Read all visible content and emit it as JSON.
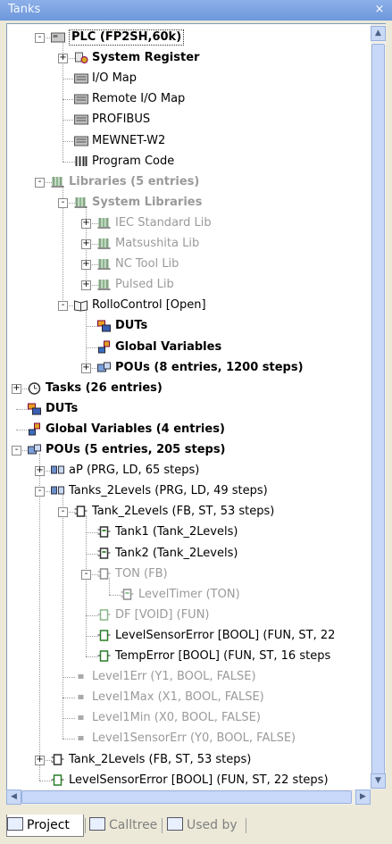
{
  "window": {
    "title": "Tanks",
    "close_label": "×"
  },
  "tree": [
    {
      "text": "PLC (FP2SH,60k)",
      "x": 2,
      "bold": true,
      "exp": "-",
      "icon": "plc-icon"
    },
    {
      "text": "System Register",
      "x": 3,
      "bold": true,
      "exp": "+",
      "icon": "system-register-icon"
    },
    {
      "text": "I/O Map",
      "x": 3,
      "icon": "io-map-icon"
    },
    {
      "text": "Remote I/O Map",
      "x": 3,
      "icon": "remote-io-map-icon"
    },
    {
      "text": "PROFIBUS",
      "x": 3,
      "icon": "profibus-icon"
    },
    {
      "text": "MEWNET-W2",
      "x": 3,
      "icon": "mewnet-icon"
    },
    {
      "text": "Program Code",
      "x": 3,
      "icon": "program-code-icon"
    },
    {
      "text": "Libraries (5 entries)",
      "x": 2,
      "bold": true,
      "gray": true,
      "exp": "-",
      "icon": "library-icon"
    },
    {
      "text": "System Libraries",
      "x": 3,
      "bold": true,
      "gray": true,
      "exp": "-",
      "icon": "library-icon"
    },
    {
      "text": "IEC Standard Lib",
      "x": 4,
      "gray": true,
      "exp": "+",
      "icon": "library-icon"
    },
    {
      "text": "Matsushita Lib",
      "x": 4,
      "gray": true,
      "exp": "+",
      "icon": "library-icon"
    },
    {
      "text": "NC Tool Lib",
      "x": 4,
      "gray": true,
      "exp": "+",
      "icon": "library-icon"
    },
    {
      "text": "Pulsed Lib",
      "x": 4,
      "gray": true,
      "exp": "+",
      "icon": "library-icon"
    },
    {
      "text": "RolloControl [Open]",
      "x": 3,
      "exp": "-",
      "icon": "open-book-icon"
    },
    {
      "text": "DUTs",
      "x": 4,
      "bold": true,
      "icon": "dut-icon"
    },
    {
      "text": "Global Variables",
      "x": 4,
      "bold": true,
      "icon": "global-variables-icon"
    },
    {
      "text": "POUs (8 entries, 1200 steps)",
      "x": 4,
      "bold": true,
      "exp": "+",
      "icon": "pou-folder-icon"
    },
    {
      "text": "Tasks (26 entries)",
      "x": 1,
      "bold": true,
      "exp": "+",
      "icon": "clock-icon"
    },
    {
      "text": "DUTs",
      "x": 1,
      "bold": true,
      "icon": "dut-icon"
    },
    {
      "text": "Global Variables (4 entries)",
      "x": 1,
      "bold": true,
      "icon": "global-variables-icon"
    },
    {
      "text": "POUs (5 entries, 205 steps)",
      "x": 1,
      "bold": true,
      "exp": "-",
      "icon": "pou-folder-icon"
    },
    {
      "text": "aP (PRG, LD, 65 steps)",
      "x": 2,
      "exp": "+",
      "icon": "program-icon"
    },
    {
      "text": "Tanks_2Levels (PRG, LD, 49 steps)",
      "x": 2,
      "exp": "-",
      "icon": "program-icon"
    },
    {
      "text": "Tank_2Levels (FB, ST, 53 steps)",
      "x": 3,
      "exp": "-",
      "icon": "function-block-icon"
    },
    {
      "text": "Tank1 (Tank_2Levels)",
      "x": 4,
      "icon": "instance-icon"
    },
    {
      "text": "Tank2 (Tank_2Levels)",
      "x": 4,
      "icon": "instance-icon"
    },
    {
      "text": "TON (FB)",
      "x": 4,
      "gray": true,
      "exp": "-",
      "icon": "function-block-icon"
    },
    {
      "text": "LevelTimer (TON)",
      "x": 5,
      "gray": true,
      "icon": "instance-icon"
    },
    {
      "text": "DF [VOID] (FUN)",
      "x": 4,
      "gray": true,
      "icon": "function-icon"
    },
    {
      "text": "LevelSensorError [BOOL] (FUN, ST, 22",
      "x": 4,
      "icon": "function-icon"
    },
    {
      "text": "TempError [BOOL] (FUN, ST, 16 steps",
      "x": 4,
      "icon": "function-icon"
    },
    {
      "text": "Level1Err (Y1, BOOL, FALSE)",
      "x": 3,
      "gray": true,
      "icon": "variable-icon"
    },
    {
      "text": "Level1Max (X1, BOOL, FALSE)",
      "x": 3,
      "gray": true,
      "icon": "variable-icon"
    },
    {
      "text": "Level1Min (X0, BOOL, FALSE)",
      "x": 3,
      "gray": true,
      "icon": "variable-icon"
    },
    {
      "text": "Level1SensorErr (Y0, BOOL, FALSE)",
      "x": 3,
      "gray": true,
      "icon": "variable-icon"
    },
    {
      "text": "Tank_2Levels (FB, ST, 53 steps)",
      "x": 2,
      "exp": "+",
      "icon": "function-block-icon"
    },
    {
      "text": "LevelSensorError [BOOL] (FUN, ST, 22 steps)",
      "x": 2,
      "icon": "function-icon"
    }
  ],
  "tabs": [
    {
      "label": "Project",
      "icon": "project-icon",
      "active": true
    },
    {
      "label": "Calltree",
      "icon": "calltree-icon",
      "active": false
    },
    {
      "label": "Used by",
      "icon": "used-by-icon",
      "active": false
    }
  ],
  "colors": {
    "title_bar": "#7aa1e0",
    "tree_bg": "#ffffff",
    "gray_text": "#9a9a9a",
    "frame": "#ece9d8"
  }
}
